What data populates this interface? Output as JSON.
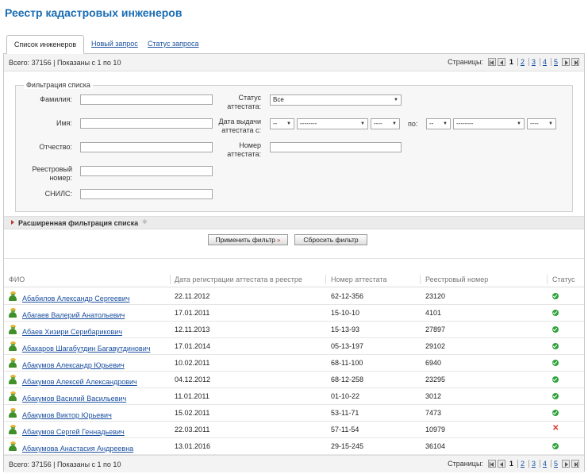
{
  "page": {
    "title": "Реестр кадастровых инженеров"
  },
  "tabs": [
    {
      "label": "Список инженеров",
      "active": true
    },
    {
      "label": "Новый запрос",
      "active": false
    },
    {
      "label": "Статус запроса",
      "active": false
    }
  ],
  "summary": {
    "text": "Всего: 37156 | Показаны с 1 по 10"
  },
  "pager": {
    "label": "Страницы:",
    "pages": [
      "1",
      "2",
      "3",
      "4",
      "5"
    ]
  },
  "filter": {
    "legend": "Фильтрация списка",
    "surname_label": "Фамилия:",
    "name_label": "Имя:",
    "patronymic_label": "Отчество:",
    "registry_number_label": "Реестровый номер:",
    "snils_label": "СНИЛС:",
    "status_label": "Статус аттестата:",
    "status_value": "Все",
    "issue_date_label": "Дата выдачи аттестата с:",
    "to_label": "по:",
    "date_from": {
      "day": "--",
      "month": "--------",
      "year": "----"
    },
    "date_to": {
      "day": "--",
      "month": "--------",
      "year": "----"
    },
    "cert_number_label": "Номер аттестата:"
  },
  "advanced_filter": {
    "label": "Расширенная фильтрация списка"
  },
  "buttons": {
    "apply": "Применить фильтр",
    "apply_marker": "»",
    "reset": "Сбросить фильтр"
  },
  "table": {
    "columns": [
      "ФИО",
      "Дата регистрации аттестата в реестре",
      "Номер аттестата",
      "Реестровый номер",
      "Статус"
    ],
    "rows": [
      {
        "name": "Абабилов Александр Сергеевич",
        "date": "22.11.2012",
        "cert": "62-12-356",
        "reg": "23120",
        "status": "active"
      },
      {
        "name": "Абагаев Валерий Анатольевич",
        "date": "17.01.2011",
        "cert": "15-10-10",
        "reg": "4101",
        "status": "active"
      },
      {
        "name": "Абаев Хизири Серибарикович",
        "date": "12.11.2013",
        "cert": "15-13-93",
        "reg": "27897",
        "status": "active"
      },
      {
        "name": "Абакаров Шагабутдин Багавутдинович",
        "date": "17.01.2014",
        "cert": "05-13-197",
        "reg": "29102",
        "status": "active"
      },
      {
        "name": "Абакумов Александр Юрьевич",
        "date": "10.02.2011",
        "cert": "68-11-100",
        "reg": "6940",
        "status": "active"
      },
      {
        "name": "Абакумов Алексей Александрович",
        "date": "04.12.2012",
        "cert": "68-12-258",
        "reg": "23295",
        "status": "active"
      },
      {
        "name": "Абакумов Василий Васильевич",
        "date": "11.01.2011",
        "cert": "01-10-22",
        "reg": "3012",
        "status": "active"
      },
      {
        "name": "Абакумов Виктор Юрьевич",
        "date": "15.02.2011",
        "cert": "53-11-71",
        "reg": "7473",
        "status": "active"
      },
      {
        "name": "Абакумов Сергей Геннадьевич",
        "date": "22.03.2011",
        "cert": "57-11-54",
        "reg": "10979",
        "status": "annulled"
      },
      {
        "name": "Абакумова Анастасия Андреевна",
        "date": "13.01.2016",
        "cert": "29-15-245",
        "reg": "36104",
        "status": "active"
      }
    ]
  },
  "colors": {
    "title": "#1a6db3",
    "link": "#1a4fa0",
    "status_ok": "#2ea33a",
    "status_bad": "#d9332a",
    "apply_marker": "#c0392b"
  }
}
